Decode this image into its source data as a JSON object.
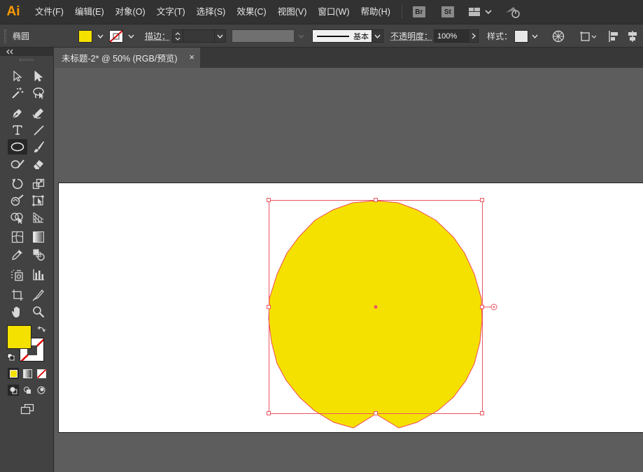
{
  "app": {
    "logo": "Ai",
    "brand_color": "#ff9a00",
    "menu": [
      "文件(F)",
      "编辑(E)",
      "对象(O)",
      "文字(T)",
      "选择(S)",
      "效果(C)",
      "视图(V)",
      "窗口(W)",
      "帮助(H)"
    ],
    "bridge_buttons": [
      "Br",
      "St"
    ],
    "icons": [
      "workspace-layout-icon",
      "chevron-down-icon",
      "gpu-sync-icon"
    ]
  },
  "control_bar": {
    "selection_name": "椭圆",
    "fill_color": "#f5e100",
    "stroke_color": "#ff0000",
    "stroke_label": "描边：",
    "stroke_weight": "",
    "stroke_style": "基本",
    "opacity_label": "不透明度：",
    "opacity_value": "100%",
    "style_label": "样式：",
    "icons": [
      "recolor-artwork-icon",
      "transform-icon",
      "align-left-icon",
      "align-center-icon"
    ]
  },
  "document": {
    "tab_title": "未标题-2* @ 50% (RGB/预览)",
    "close_glyph": "×",
    "canvas_color": "#5d5d5d",
    "artboard_color": "#ffffff"
  },
  "artwork": {
    "shape": "ellipse",
    "fill": "#f5e100",
    "stroke": "#ef4a55",
    "selection_color": "#ea5460",
    "selected": true
  },
  "tools": {
    "active_tool": "ellipse-tool",
    "fill_color": "#f5e100",
    "stroke_color": "#ffffff",
    "list": [
      "selection-tool",
      "direct-selection-tool",
      "magic-wand-tool",
      "lasso-tool",
      "pen-tool",
      "curvature-tool",
      "type-tool",
      "line-segment-tool",
      "ellipse-tool",
      "paintbrush-tool",
      "shaper-tool",
      "eraser-tool",
      "rotate-tool",
      "scale-tool",
      "warp-tool",
      "free-transform-tool",
      "shape-builder-tool",
      "perspective-grid-tool",
      "mesh-tool",
      "gradient-tool",
      "eyedropper-tool",
      "blend-tool",
      "symbol-sprayer-tool",
      "column-graph-tool",
      "artboard-tool",
      "slice-tool",
      "hand-tool",
      "zoom-tool"
    ]
  }
}
